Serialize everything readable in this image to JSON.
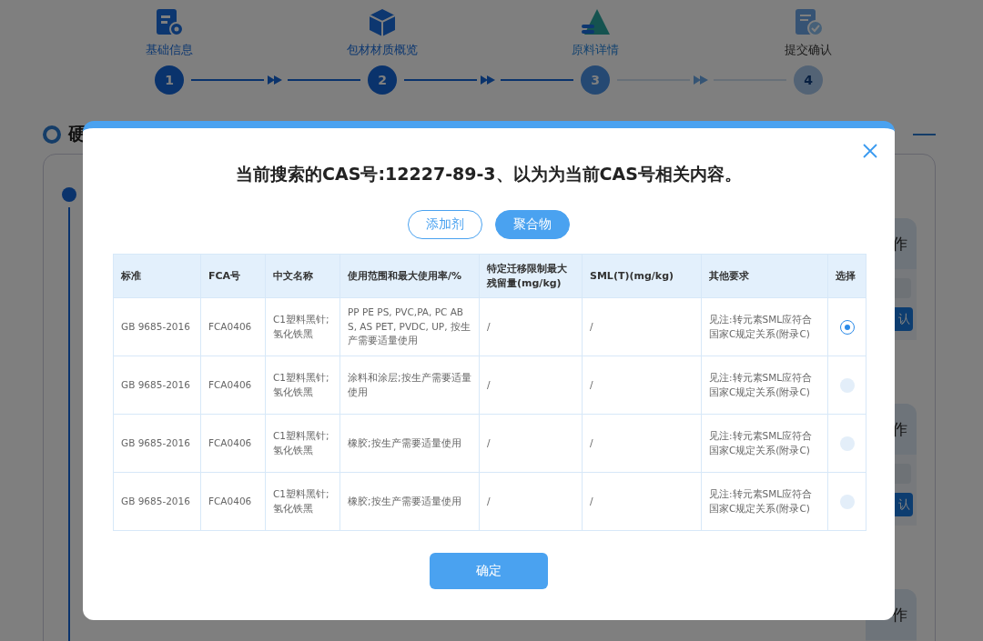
{
  "steps": [
    {
      "label": "基础信息",
      "number": "1",
      "kind": "done"
    },
    {
      "label": "包材材质概览",
      "number": "2",
      "kind": "done"
    },
    {
      "label": "原料详情",
      "number": "3",
      "kind": "current"
    },
    {
      "label": "提交确认",
      "number": "4",
      "kind": "todo"
    }
  ],
  "section": {
    "title": "硬"
  },
  "side_panels": [
    {
      "header": "作",
      "button": "认"
    },
    {
      "header": "作",
      "button": "认"
    },
    {
      "header": "作"
    }
  ],
  "dialog": {
    "title": "当前搜索的CAS号:12227-89-3、以为为当前CAS号相关内容。",
    "filter_tabs": [
      {
        "label": "添加剂",
        "selected": false
      },
      {
        "label": "聚合物",
        "selected": true
      }
    ],
    "table": {
      "columns": [
        "标准",
        "FCA号",
        "中文名称",
        "使用范围和最大使用率/%",
        "特定迁移限制最大残留量(mg/kg)",
        "SML(T)(mg/kg)",
        "其他要求",
        "选择"
      ],
      "rows": [
        {
          "cells": [
            "GB 9685-2016",
            "FCA0406",
            "C1塑料黑针;氢化铁黑",
            "PP PE PS, PVC,PA, PC ABS, AS PET, PVDC, UP, 按生产需要适量使用",
            "/",
            "/",
            "见注:转元素SML应符合国家C规定关系(附录C)"
          ],
          "selected": true
        },
        {
          "cells": [
            "GB 9685-2016",
            "FCA0406",
            "C1塑料黑针;氢化铁黑",
            "涂料和涂层;按生产需要适量使用",
            "/",
            "/",
            "见注:转元素SML应符合国家C规定关系(附录C)"
          ],
          "selected": false
        },
        {
          "cells": [
            "GB 9685-2016",
            "FCA0406",
            "C1塑料黑针;氢化铁黑",
            "橡胶;按生产需要适量使用",
            "/",
            "/",
            "见注:转元素SML应符合国家C规定关系(附录C)"
          ],
          "selected": false
        },
        {
          "cells": [
            "GB 9685-2016",
            "FCA0406",
            "C1塑料黑针;氢化铁黑",
            "橡胶;按生产需要适量使用",
            "/",
            "/",
            "见注:转元素SML应符合国家C规定关系(附录C)"
          ],
          "selected": false
        }
      ]
    },
    "confirm_button": "确定"
  }
}
